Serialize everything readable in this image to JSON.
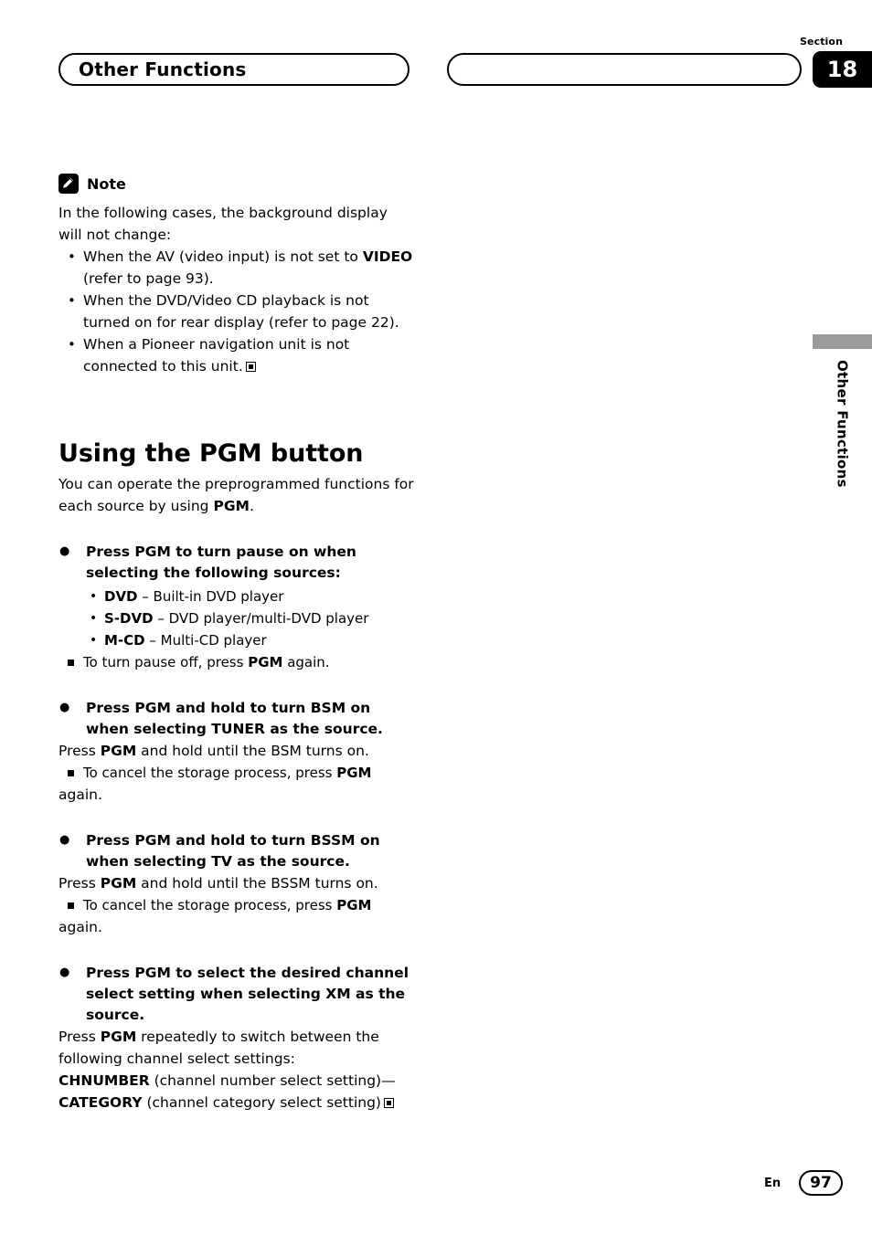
{
  "header": {
    "title": "Other Functions",
    "section_label": "Section",
    "section_number": "18"
  },
  "side_tab": {
    "label": "Other Functions"
  },
  "note": {
    "icon": "pencil-note-icon",
    "label": "Note",
    "intro": "In the following cases, the background display will not change:",
    "items": [
      {
        "pre": "When the AV (video input) is not set to ",
        "bold": "VIDEO",
        "post": " (refer to page 93)."
      },
      {
        "pre": "When the DVD/Video CD playback is not turned on for rear display (refer to page 22).",
        "bold": "",
        "post": ""
      },
      {
        "pre": "When a Pioneer navigation unit is not connected to this unit.",
        "bold": "",
        "post": ""
      }
    ]
  },
  "section": {
    "heading": "Using the PGM button",
    "intro_pre": "You can operate the preprogrammed functions for each source by using ",
    "intro_bold": "PGM",
    "intro_post": "."
  },
  "blocks": [
    {
      "command": "Press PGM to turn pause on when selecting the following sources:",
      "sub_items": [
        {
          "bold": "DVD",
          "rest": " – Built-in DVD player"
        },
        {
          "bold": "S-DVD",
          "rest": " – DVD player/multi-DVD player"
        },
        {
          "bold": "M-CD",
          "rest": " – Multi-CD player"
        }
      ],
      "square_pre": "To turn pause off, press ",
      "square_bold": "PGM",
      "square_post": " again.",
      "body_pre": "",
      "body_bold": "",
      "body_post": "",
      "tail": ""
    },
    {
      "command": "Press PGM and hold to turn BSM on when selecting TUNER as the source.",
      "sub_items": [],
      "body_pre": "Press ",
      "body_bold": "PGM",
      "body_post": " and hold until the BSM turns on.",
      "square_pre": "To cancel the storage process, press ",
      "square_bold": "PGM",
      "square_post": "",
      "tail": "again."
    },
    {
      "command": "Press PGM and hold to turn BSSM on when selecting TV as the source.",
      "sub_items": [],
      "body_pre": "Press ",
      "body_bold": "PGM",
      "body_post": " and hold until the BSSM turns on.",
      "square_pre": "To cancel the storage process, press ",
      "square_bold": "PGM",
      "square_post": "",
      "tail": "again."
    }
  ],
  "xm_block": {
    "command": "Press PGM to select the desired channel select setting when selecting XM as the source.",
    "body_pre": "Press ",
    "body_bold": "PGM",
    "body_post": " repeatedly to switch between the following channel select settings:",
    "setting1_bold": "CHNUMBER",
    "setting1_rest": " (channel number select setting)",
    "setting2_dash": "—",
    "setting2_bold": "CATEGORY",
    "setting2_rest": " (channel category select setting)"
  },
  "footer": {
    "language": "En",
    "page_number": "97"
  }
}
